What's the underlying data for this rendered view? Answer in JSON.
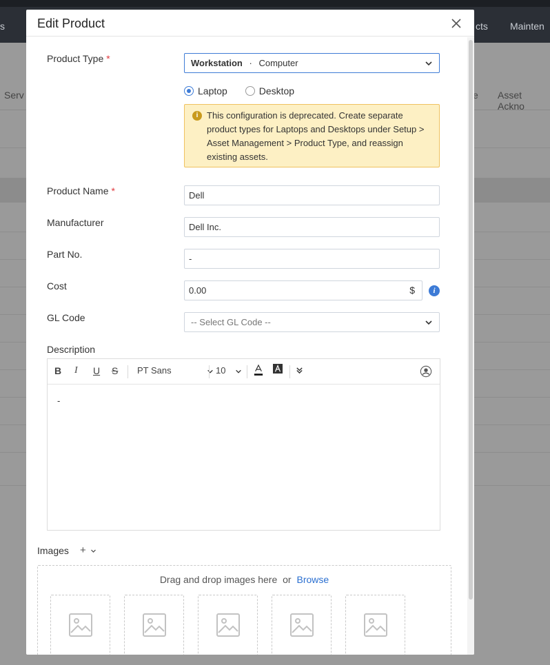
{
  "background": {
    "nav_left": "s",
    "nav_cts": "cts",
    "nav_maint": "Mainten",
    "tab_left": "Serv",
    "tab_e": "e",
    "tab_right": "Asset Ackno"
  },
  "modal": {
    "title": "Edit Product",
    "product_type": {
      "label": "Product Type",
      "required_mark": "*",
      "value_bold": "Workstation",
      "value_sep": "·",
      "value_rest": "Computer"
    },
    "radios": [
      {
        "label": "Laptop",
        "selected": true
      },
      {
        "label": "Desktop",
        "selected": false
      }
    ],
    "warning": {
      "icon": "i",
      "text": "This configuration is deprecated. Create separate product types for Laptops and Desktops under Setup > Asset Management > Product Type, and reassign existing assets."
    },
    "product_name": {
      "label": "Product Name",
      "required_mark": "*",
      "value": "Dell"
    },
    "manufacturer": {
      "label": "Manufacturer",
      "value": "Dell Inc."
    },
    "part_no": {
      "label": "Part No.",
      "value": "-"
    },
    "cost": {
      "label": "Cost",
      "value": "0.00",
      "currency": "$"
    },
    "gl_code": {
      "label": "GL Code",
      "placeholder": "-- Select GL Code --"
    },
    "description": {
      "label": "Description",
      "font": "PT Sans",
      "size": "10",
      "content": "-"
    },
    "images": {
      "label": "Images",
      "add": "+",
      "drop_text": "Drag and drop images here",
      "or_text": "or",
      "browse": "Browse"
    }
  }
}
